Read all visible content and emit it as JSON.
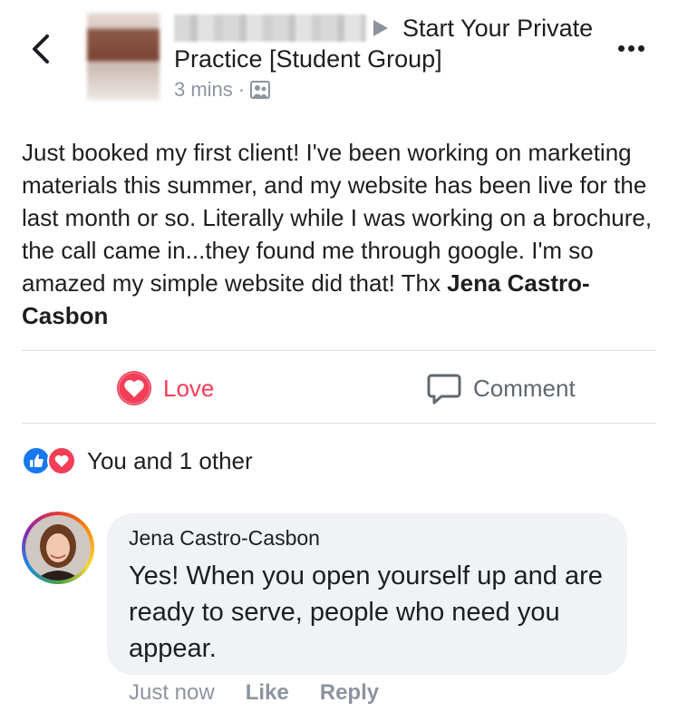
{
  "header": {
    "group_title": "Start Your Private Practice [Student Group]",
    "time": "3 mins",
    "separator": "·"
  },
  "post": {
    "text": "Just booked my first client! I've been working on marketing materials this summer, and my website has been live for the last month or so.  Literally while I was working on a brochure, the call came in...they found me through google.  I'm so amazed my simple website did that! Thx ",
    "mention": "Jena Castro-Casbon"
  },
  "actions": {
    "love_label": "Love",
    "comment_label": "Comment"
  },
  "reactions": {
    "summary": "You and 1 other"
  },
  "comment": {
    "author": "Jena Castro-Casbon",
    "text": "Yes! When you open yourself up and are ready to serve, people who need you appear.",
    "time": "Just now",
    "like_label": "Like",
    "reply_label": "Reply"
  },
  "colors": {
    "love": "#f33e58",
    "like": "#1877f2",
    "muted": "#8d949e",
    "bubble": "#f0f2f5"
  },
  "icons": [
    "back-chevron-icon",
    "more-icon",
    "group-privacy-icon",
    "love-icon",
    "comment-icon",
    "like-reaction-icon",
    "love-reaction-icon"
  ]
}
